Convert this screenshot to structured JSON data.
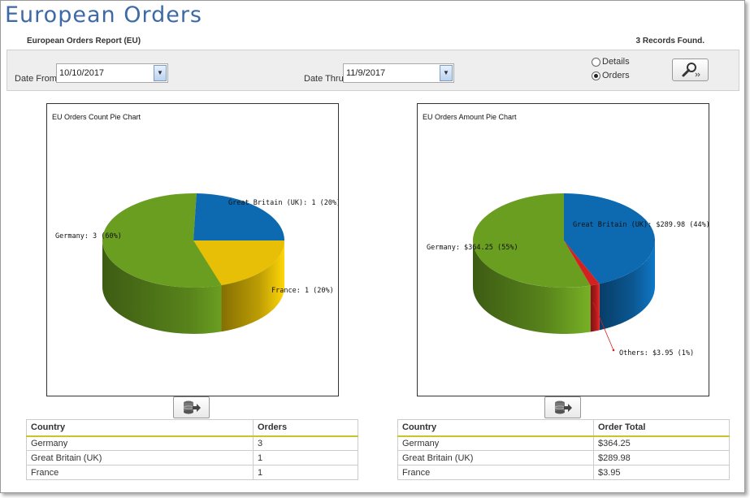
{
  "page": {
    "title": "European Orders",
    "report_name": "European Orders Report (EU)",
    "records_found": "3 Records Found."
  },
  "filters": {
    "date_from_label": "Date From",
    "date_from_value": "10/10/2017",
    "date_thru_label": "Date Thru",
    "date_thru_value": "11/9/2017",
    "view_options": [
      {
        "label": "Details",
        "selected": false
      },
      {
        "label": "Orders",
        "selected": true
      }
    ],
    "search_icon": "search-icon"
  },
  "chart_data": [
    {
      "type": "pie",
      "title": "EU Orders Count Pie Chart",
      "categories": [
        "Germany",
        "Great Britain (UK)",
        "France"
      ],
      "values": [
        3,
        1,
        1
      ],
      "colors": [
        "#6a9e21",
        "#0d6ab1",
        "#e6bf06"
      ],
      "labels": [
        "Germany: 3 (60%)",
        "Great Britain (UK): 1 (20%)",
        "France: 1 (20%)"
      ]
    },
    {
      "type": "pie",
      "title": "EU Orders Amount Pie Chart",
      "categories": [
        "Germany",
        "Great Britain (UK)",
        "Others"
      ],
      "values": [
        364.25,
        289.98,
        3.95
      ],
      "colors": [
        "#6a9e21",
        "#0d6ab1",
        "#d42020"
      ],
      "labels": [
        "Germany: $364.25 (55%)",
        "Great Britain (UK): $289.98 (44%)",
        "Others: $3.95 (1%)"
      ]
    }
  ],
  "tables": {
    "count": {
      "headers": [
        "Country",
        "Orders"
      ],
      "rows": [
        [
          "Germany",
          "3"
        ],
        [
          "Great Britain (UK)",
          "1"
        ],
        [
          "France",
          "1"
        ]
      ]
    },
    "amount": {
      "headers": [
        "Country",
        "Order Total"
      ],
      "rows": [
        [
          "Germany",
          "$364.25"
        ],
        [
          "Great Britain (UK)",
          "$289.98"
        ],
        [
          "France",
          "$3.95"
        ]
      ]
    }
  }
}
